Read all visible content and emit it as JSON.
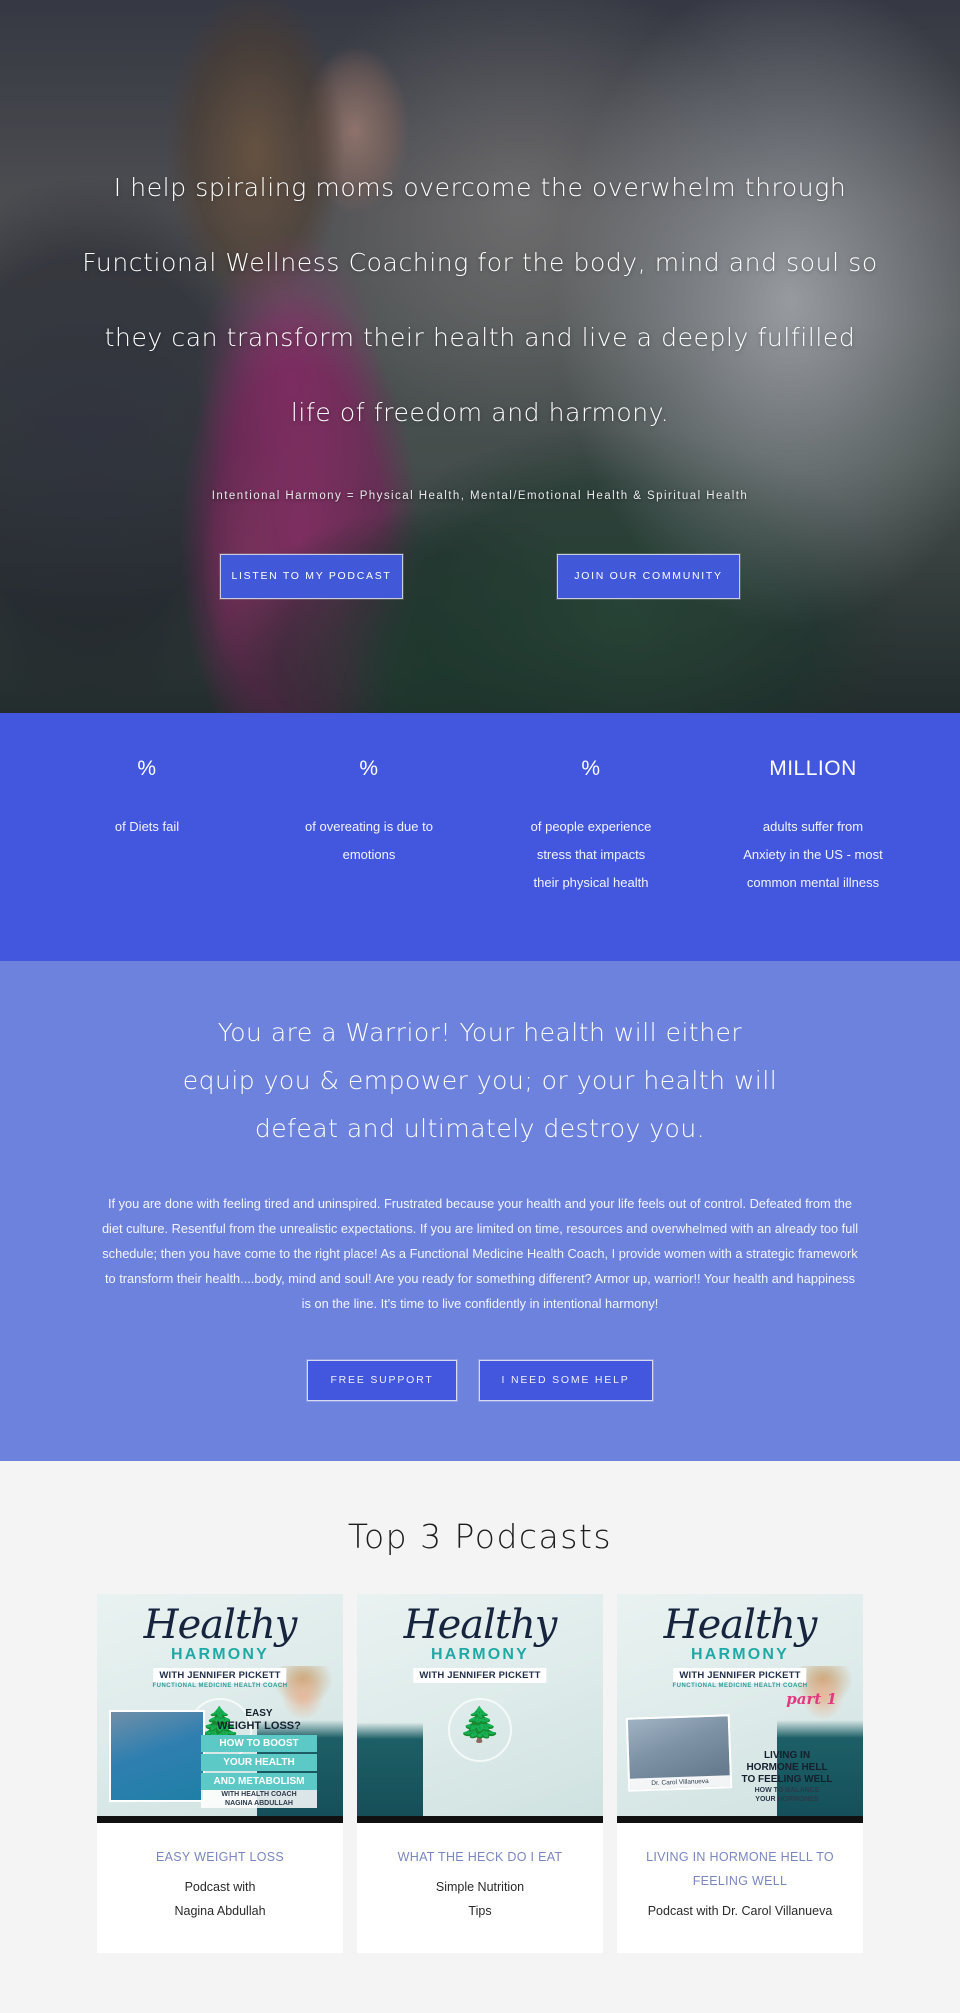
{
  "hero": {
    "headline_lines": [
      "I help spiraling moms overcome the overwhelm through",
      "Functional Wellness Coaching for the body, mind and soul so",
      "they can transform their health and live a deeply fulfilled",
      "life of freedom and harmony."
    ],
    "subtitle": "Intentional Harmony = Physical Health, Mental/Emotional Health & Spiritual Health",
    "buttons": [
      {
        "label": "LISTEN TO MY PODCAST",
        "name": "listen-to-my-podcast-button"
      },
      {
        "label": "JOIN OUR COMMUNITY",
        "name": "join-our-community-button"
      }
    ]
  },
  "stats": {
    "background_color": "#4257dd",
    "items": [
      {
        "number": "%",
        "label_lines": [
          "of Diets fail"
        ]
      },
      {
        "number": "%",
        "label_lines": [
          "of overeating is due to",
          "emotions"
        ]
      },
      {
        "number": "%",
        "label_lines": [
          "of people experience",
          "stress that impacts",
          "their physical health"
        ]
      },
      {
        "number": "MILLION",
        "label_lines": [
          "adults suffer from",
          "Anxiety in the US - most",
          "common mental illness"
        ]
      }
    ]
  },
  "warrior": {
    "background_color": "#6d82dd",
    "heading_lines": [
      "You are a Warrior! Your health will either",
      "equip you & empower you; or your health will",
      "defeat and ultimately destroy you."
    ],
    "body": "If you are done with feeling tired and uninspired.  Frustrated because your health and your life feels out of control.  Defeated from the diet culture.  Resentful from the unrealistic expectations. If you are limited on time, resources and overwhelmed with an already too full schedule; then you have come to the right place!  As a Functional Medicine Health Coach, I provide women with a strategic framework to transform their health....body, mind and soul!  Are you ready for something different?  Armor up, warrior!!  Your health and happiness is on the line.  It's time to live confidently in intentional harmony!",
    "buttons": [
      {
        "label": "FREE SUPPORT",
        "name": "free-support-button"
      },
      {
        "label": "I NEED SOME HELP",
        "name": "i-need-some-help-button"
      }
    ]
  },
  "podcasts": {
    "title": "Top 3 Podcasts",
    "accent_color": "#7a86bf",
    "cards": [
      {
        "title": "EASY WEIGHT LOSS",
        "sub_lines": [
          "Podcast with",
          "Nagina Abdullah"
        ],
        "thumb": {
          "brand_script": "Healthy",
          "brand_word": "HARMONY",
          "brand_with": "WITH JENNIFER PICKETT",
          "brand_role": "FUNCTIONAL MEDICINE HEALTH COACH",
          "overlay_line1": "EASY",
          "overlay_line2": "WEIGHT LOSS?",
          "overlay_band1": "HOW TO BOOST",
          "overlay_band2": "YOUR HEALTH",
          "overlay_band3": "AND METABOLISM",
          "overlay_credit1": "WITH HEALTH COACH",
          "overlay_credit2": "NAGINA ABDULLAH"
        }
      },
      {
        "title": "WHAT THE HECK DO I EAT",
        "sub_lines": [
          "Simple Nutrition",
          "Tips"
        ],
        "thumb": {
          "brand_script": "Healthy",
          "brand_word": "HARMONY",
          "brand_with": "WITH JENNIFER PICKETT",
          "brand_role": "",
          "overlay_line1": "",
          "overlay_line2": "",
          "overlay_band1": "",
          "overlay_band2": "",
          "overlay_band3": "",
          "overlay_credit1": "",
          "overlay_credit2": ""
        }
      },
      {
        "title": "LIVING IN HORMONE HELL TO FEELING WELL",
        "sub_lines": [
          "Podcast with Dr. Carol Villanueva"
        ],
        "thumb": {
          "brand_script": "Healthy",
          "brand_word": "HARMONY",
          "brand_with": "WITH JENNIFER PICKETT",
          "brand_role": "FUNCTIONAL MEDICINE HEALTH COACH",
          "part_label": "part 1",
          "overlay_line1": "LIVING IN",
          "overlay_line2": "HORMONE HELL",
          "overlay_band1": "TO FEELING WELL",
          "overlay_band2": "HOW TO BALANCE",
          "overlay_band3": "YOUR HORMONES",
          "guest_caption": "Dr. Carol Villanueva"
        }
      }
    ]
  }
}
